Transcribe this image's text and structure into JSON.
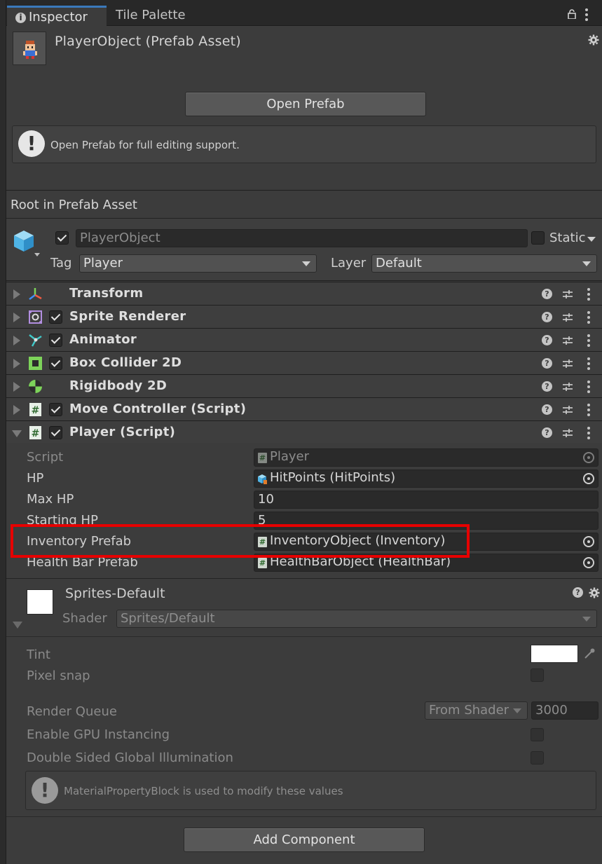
{
  "tabs": {
    "inspector": "Inspector",
    "tile_palette": "Tile Palette"
  },
  "asset": {
    "title": "PlayerObject (Prefab Asset)"
  },
  "open_prefab": {
    "label": "Open Prefab",
    "help": "Open Prefab for full editing support."
  },
  "root_label": "Root in Prefab Asset",
  "gameobject": {
    "name": "PlayerObject",
    "static_label": "Static",
    "tag_label": "Tag",
    "tag_value": "Player",
    "layer_label": "Layer",
    "layer_value": "Default"
  },
  "components": [
    {
      "name": "Transform",
      "icon": "transform-icon",
      "enabled": null
    },
    {
      "name": "Sprite Renderer",
      "icon": "sprite-renderer-icon",
      "enabled": true
    },
    {
      "name": "Animator",
      "icon": "animator-icon",
      "enabled": true
    },
    {
      "name": "Box Collider 2D",
      "icon": "box-collider-icon",
      "enabled": true
    },
    {
      "name": "Rigidbody 2D",
      "icon": "rigidbody-icon",
      "enabled": null
    },
    {
      "name": "Move Controller (Script)",
      "icon": "script-icon",
      "enabled": true
    },
    {
      "name": "Player (Script)",
      "icon": "script-icon",
      "enabled": true
    }
  ],
  "player_script": {
    "script_label": "Script",
    "script_value": "Player",
    "hp_label": "HP",
    "hp_value": "HitPoints (HitPoints)",
    "maxhp_label": "Max HP",
    "maxhp_value": "10",
    "starthp_label": "Starting HP",
    "starthp_value": "5",
    "inventory_label": "Inventory Prefab",
    "inventory_value": "InventoryObject (Inventory)",
    "healthbar_label": "Health Bar Prefab",
    "healthbar_value": "HealthBarObject (HealthBar)"
  },
  "material": {
    "name": "Sprites-Default",
    "shader_label": "Shader",
    "shader_value": "Sprites/Default",
    "tint_label": "Tint",
    "pixelsnap_label": "Pixel snap",
    "renderqueue_label": "Render Queue",
    "renderqueue_mode": "From Shader",
    "renderqueue_value": "3000",
    "gpu_label": "Enable GPU Instancing",
    "dsgi_label": "Double Sided Global Illumination",
    "help": "MaterialPropertyBlock is used to modify these values",
    "tint_color": "#ffffff"
  },
  "add_component": "Add Component",
  "colors": {
    "accent": "#3a79bb",
    "highlight": "#e60000",
    "script_icon": "#2f6a2f"
  }
}
